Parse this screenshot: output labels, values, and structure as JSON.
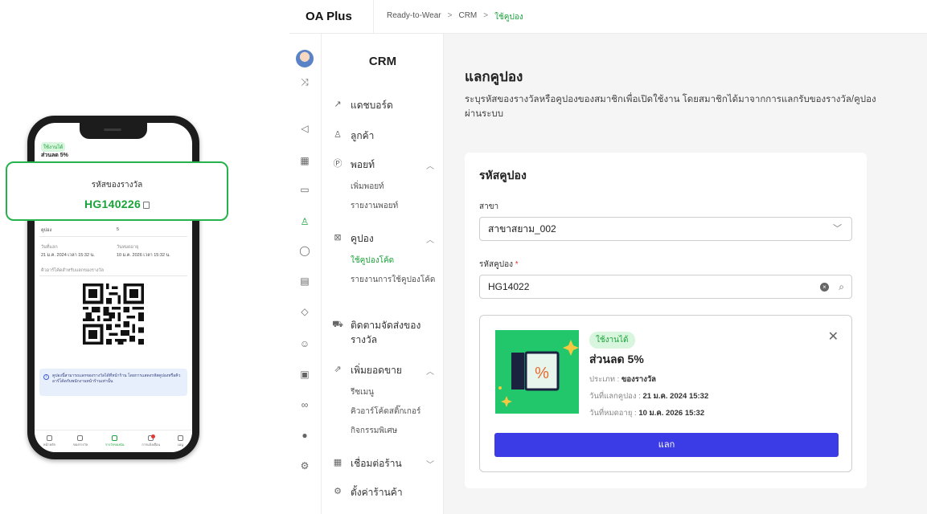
{
  "phone": {
    "badge": "ใช้งานได้",
    "title": "ส่วนลด 5%",
    "rows": {
      "qty_label": "คูปอง",
      "qty_value": "5",
      "redeem_label": "วันที่แลก",
      "redeem_value": "21 ม.ค. 2024 เวลา 15:32 น.",
      "expire_label": "วันหมดอายุ",
      "expire_value": "10 ม.ค. 2026 เวลา 15:32 น.",
      "qr_caption": "คิวอาร์โค้ดสำหรับแลกของรางวัล"
    },
    "info": "คูปองนี้สามารถแลกของรางวัลได้ที่หน้าร้าน โดยการแสดงรหัสคูปองหรือคิวอาร์โค้ดกับพนักงานหน้าร้านเท่านั้น",
    "tabs": [
      "หน้าหลัก",
      "ของรางวัล",
      "รางวัลของฉัน",
      "การแจ้งเตือน",
      "เมนู"
    ],
    "reward_label": "รหัสของรางวัล",
    "reward_code": "HG140226"
  },
  "header": {
    "brand": "OA Plus",
    "breadcrumbs": [
      "Ready-to-Wear",
      "CRM",
      "ใช้คูปอง"
    ],
    "crumb_sep": ">"
  },
  "subnav": {
    "title": "CRM",
    "items": {
      "dashboard": "แดชบอร์ด",
      "customer": "ลูกค้า",
      "point": "พอยท์",
      "point_add": "เพิ่มพอยท์",
      "point_report": "รายงานพอยท์",
      "coupon": "คูปอง",
      "coupon_use": "ใช้คูปองโค้ด",
      "coupon_report": "รายงานการใช้คูปองโค้ด",
      "tracking": "ติดตามจัดส่งของรางวัล",
      "sales": "เพิ่มยอดขาย",
      "receipt": "รีซเมนู",
      "qr_sticker": "คิวอาร์โค้ดสติ๊กเกอร์",
      "activity": "กิจกรรมพิเศษ",
      "connect": "เชื่อมต่อร้าน",
      "settings": "ตั้งค่าร้านค้า"
    }
  },
  "main": {
    "title": "แลกคูปอง",
    "description": "ระบุรหัสของรางวัลหรือคูปองของสมาชิกเพื่อเปิดใช้งาน โดยสมาชิกได้มาจากการแลกรับของรางวัล/คูปองผ่านระบบ",
    "card_title": "รหัสคูปอง",
    "branch_label": "สาขา",
    "branch_value": "สาขาสยาม_002",
    "code_label": "รหัสคูปอง",
    "required_mark": "*",
    "code_value": "HG14022"
  },
  "coupon": {
    "status": "ใช้งานได้",
    "name": "ส่วนลด 5%",
    "type_label": "ประเภท : ",
    "type_value": "ของรางวัล",
    "redeemed_label": "วันที่แลกคูปอง : ",
    "redeemed_value": "21 ม.ค. 2024 15:32",
    "expire_label": "วันที่หมดอายุ : ",
    "expire_value": "10 ม.ค. 2026 15:32",
    "redeem_button": "แลก"
  },
  "colors": {
    "brand_green": "#1aa33a",
    "primary_button": "#3b3ce6",
    "coupon_art_bg": "#22c76b"
  }
}
